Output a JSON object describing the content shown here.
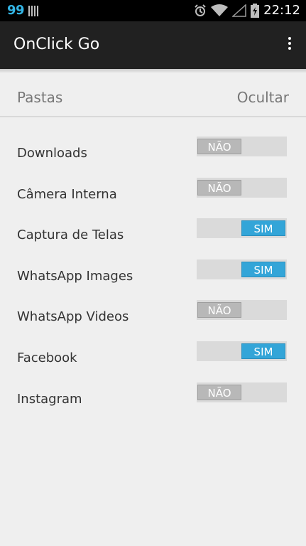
{
  "status_bar": {
    "notification_count": "99",
    "time": "22:12",
    "icons": [
      "barcode-icon",
      "alarm-icon",
      "wifi-icon",
      "signal-icon",
      "battery-charging-icon"
    ]
  },
  "action_bar": {
    "title": "OnClick Go",
    "menu_icon": "overflow-menu-icon"
  },
  "header": {
    "left_label": "Pastas",
    "right_label": "Ocultar"
  },
  "folders": [
    {
      "name": "Downloads",
      "toggle_label": "NÃO",
      "state": "off"
    },
    {
      "name": "Câmera Interna",
      "toggle_label": "NÃO",
      "state": "off"
    },
    {
      "name": "Captura de Telas",
      "toggle_label": "SIM",
      "state": "on"
    },
    {
      "name": "WhatsApp Images",
      "toggle_label": "SIM",
      "state": "on"
    },
    {
      "name": "WhatsApp Videos",
      "toggle_label": "NÃO",
      "state": "off"
    },
    {
      "name": "Facebook",
      "toggle_label": "SIM",
      "state": "on"
    },
    {
      "name": "Instagram",
      "toggle_label": "NÃO",
      "state": "off"
    }
  ],
  "colors": {
    "accent": "#33a5d8",
    "action_bar": "#212121",
    "background": "#efefef"
  }
}
